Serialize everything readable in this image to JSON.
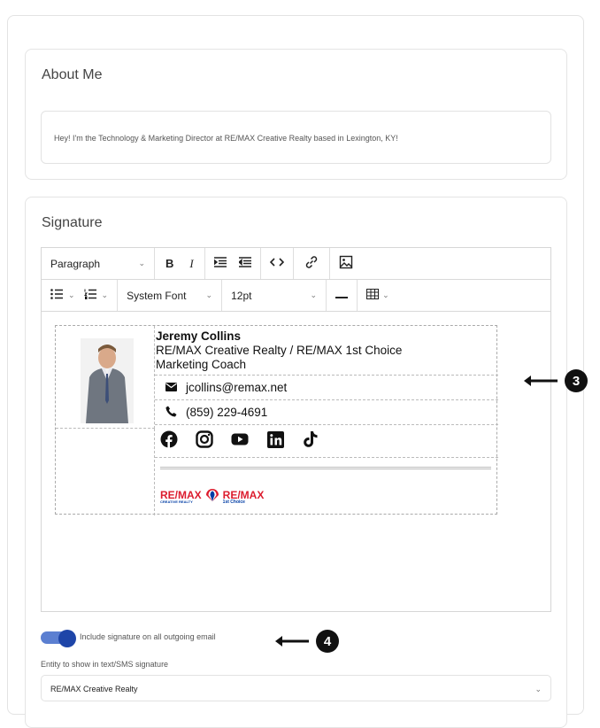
{
  "about": {
    "title": "About Me",
    "text": "Hey! I'm the Technology & Marketing Director at RE/MAX Creative Realty based in Lexington, KY!"
  },
  "signature": {
    "title": "Signature",
    "toolbar": {
      "block_format": "Paragraph",
      "bold": "B",
      "italic": "I",
      "font_family": "System Font",
      "font_size": "12pt"
    },
    "card": {
      "name": "Jeremy Collins",
      "company": "RE/MAX Creative Realty / RE/MAX 1st Choice",
      "role": "Marketing Coach",
      "email": "jcollins@remax.net",
      "phone": "(859) 229-4691",
      "socials": [
        "facebook-icon",
        "instagram-icon",
        "youtube-icon",
        "linkedin-icon",
        "tiktok-icon"
      ],
      "logo1_main": "RE/MAX",
      "logo1_sub": "CREATIVE REALTY",
      "logo2_main": "RE/MAX",
      "logo2_sub": "1st Choice"
    },
    "toggle_label": "Include signature on all outgoing email",
    "toggle_on": true,
    "entity_label": "Entity to show in text/SMS signature",
    "entity_value": "RE/MAX Creative Realty"
  },
  "annotations": [
    "3",
    "4"
  ],
  "colors": {
    "toggle": "#1e45a8",
    "remax_red": "#dc1c2e",
    "remax_blue": "#003da5"
  }
}
